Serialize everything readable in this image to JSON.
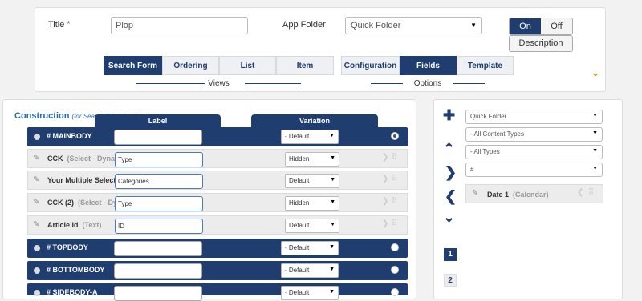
{
  "form": {
    "title_label": "Title",
    "required_mark": "*",
    "title_value": "Plop",
    "app_folder_label": "App Folder",
    "app_folder_value": "Quick Folder",
    "toggle_on": "On",
    "toggle_off": "Off",
    "description_button": "Description"
  },
  "views_tabs": [
    "Search Form",
    "Ordering",
    "List",
    "Item"
  ],
  "views_caption": "Views",
  "options_tabs": [
    "Configuration",
    "Fields",
    "Template"
  ],
  "options_caption": "Options",
  "construction": {
    "title": "Construction",
    "subtitle": "(for Search Form view)",
    "col_label": "Label",
    "col_variation": "Variation"
  },
  "rows": [
    {
      "name": "# MAINBODY",
      "type": "",
      "label": "",
      "variation": "- Default"
    },
    {
      "name": "CCK",
      "type": "(Select - Dynamic)",
      "label": "Type",
      "variation": "Hidden"
    },
    {
      "name": "Your Multiple Select",
      "type": "",
      "label": "Categories",
      "variation": "Default"
    },
    {
      "name": "CCK (2)",
      "type": "(Select - Dynamic)",
      "label": "Type",
      "variation": "Hidden"
    },
    {
      "name": "Article Id",
      "type": "(Text)",
      "label": "ID",
      "variation": "Default"
    },
    {
      "name": "# TOPBODY",
      "type": "",
      "label": "",
      "variation": "- Default"
    },
    {
      "name": "# BOTTOMBODY",
      "type": "",
      "label": "",
      "variation": "- Default"
    },
    {
      "name": "# SIDEBODY-A",
      "type": "",
      "label": "",
      "variation": "- Default"
    }
  ],
  "filters": {
    "folder": "Quick Folder",
    "content_types": "- All Content Types",
    "types": "- All Types",
    "search": "#"
  },
  "available_field": {
    "name": "Date 1",
    "type": "(Calendar)"
  },
  "pages": [
    "1",
    "2"
  ],
  "colors": {
    "primary": "#1f3d6e",
    "accent": "#e8940c",
    "link": "#2a6aa8"
  },
  "icons": [
    "plus-icon",
    "chevron-up-icon",
    "chevron-right-icon",
    "chevron-left-icon",
    "chevron-down-icon",
    "pencil-icon",
    "grip-icon"
  ]
}
